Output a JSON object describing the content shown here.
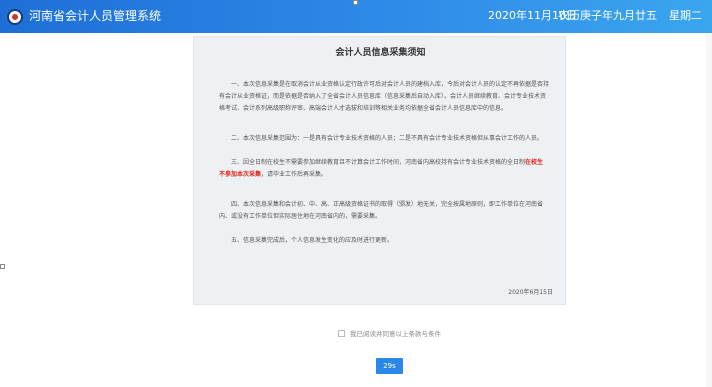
{
  "header": {
    "title": "河南省会计人员管理系统",
    "date": "2020年11月10日",
    "lunar_date": "农历庚子年九月廿五",
    "weekday": "星期二",
    "logo_icon": "emblem-icon"
  },
  "notice": {
    "title": "会计人员信息采集须知",
    "para1": "一、本次信息采集是在取消会计从业资格认定行政许可后对会计人员的建档入库，今后对会计人员的认定不再依据是否持有会计从业资格证，而是依据是否纳入了全省会计人员信息库（信息采集后自动入库）。会计人员继续教育、会计专业技术资格考试、会计系列高级职称评审、高端会计人才选拔和培训等相关业务均依据全省会计人员信息库中的信息。",
    "para2": "二、本次信息采集范围为：一是具有会计专业技术资格的人员；二是不具有会计专业技术资格但从事会计工作的人员。",
    "para3_before": "三、因全日制在校生不需要参加继续教育且不计算会计工作时间，河南省内高校持有会计专业技术资格的全日制",
    "para3_highlight": "在校生不参加本次采集",
    "para3_after": "，请毕业工作后再采集。",
    "para4": "四、本次信息采集和会计初、中、高、正高级资格证书的取得（颁发）地无关，完全按属地原则，即工作单位在河南省内、或没有工作单位但实际居住地在河南省内的，需要采集。",
    "para5": "五、信息采集完成后，个人信息发生变化的应及时进行更新。",
    "sign_date": "2020年6月15日"
  },
  "agreement": {
    "label": "我已阅读并同意以上条款与条件",
    "checked": false
  },
  "confirm_button": {
    "label": "29s"
  },
  "colors": {
    "header_gradient_start": "#1d6fd6",
    "header_gradient_end": "#3aa6ee",
    "highlight": "#e0241c",
    "button": "#2b88e6",
    "panel_bg": "#edf1f4"
  }
}
